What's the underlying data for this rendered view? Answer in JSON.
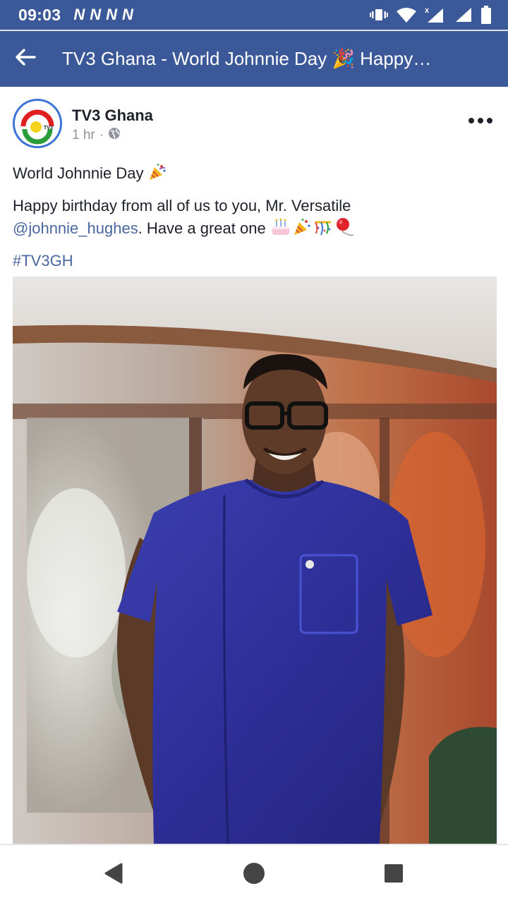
{
  "status_bar": {
    "time": "09:03",
    "notification_icons": [
      "N",
      "N",
      "N",
      "N"
    ],
    "icons": [
      "vibrate-icon",
      "wifi-icon",
      "signal-x-icon",
      "signal-icon",
      "battery-icon"
    ]
  },
  "app_bar": {
    "title": "TV3 Ghana - World Johnnie Day 🎉 Happy…",
    "back_icon": "back-arrow-icon"
  },
  "post": {
    "page_name": "TV3 Ghana",
    "time": "1 hr",
    "separator": "·",
    "privacy_icon": "globe-icon",
    "avatar_logo": "TV3",
    "line1": "World Johnnie Day",
    "line2": "Happy birthday from all of us to you, Mr. Versatile",
    "mention": "@johnnie_hughes",
    "line3_after_mention": ". Have a great one",
    "hashtag": "#TV3GH",
    "emojis": [
      "party-popper",
      "birthday-cake",
      "party-popper",
      "confetti",
      "balloon"
    ]
  },
  "nav_bar": {
    "icons": [
      "back-triangle-icon",
      "home-circle-icon",
      "recents-square-icon"
    ]
  },
  "colors": {
    "brand_blue": "#3b5998",
    "link_blue": "#4b67a1",
    "text": "#1d2129",
    "meta_gray": "#90949c"
  }
}
